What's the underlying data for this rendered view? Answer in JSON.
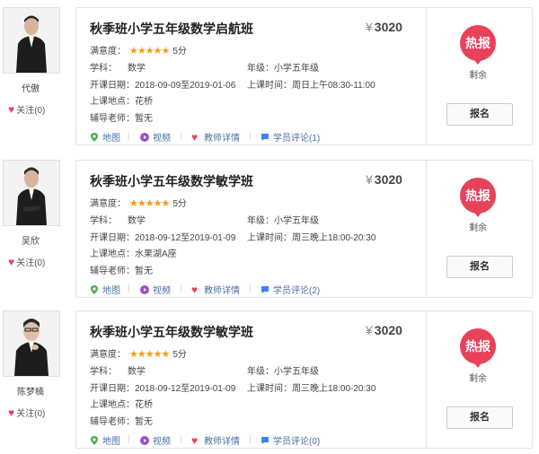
{
  "labels": {
    "follow": "关注(0)",
    "satisfaction": "满意度：",
    "subject": "学科：",
    "grade": "年级：",
    "dates": "开课日期：",
    "time": "上课时间：",
    "location": "上课地点：",
    "tutor": "辅导老师：",
    "badge": "热报",
    "remain": "剩余",
    "signup": "报名",
    "map": "地图",
    "video": "视频",
    "teacher_detail": "教师详情",
    "currency": "¥"
  },
  "courses": [
    {
      "teacher": "代傲",
      "title": "秋季班小学五年级数学启航班",
      "price": "3020",
      "stars": "★★★★★",
      "score": "5分",
      "subject": "数学",
      "grade": "小学五年级",
      "dates": "2018-09-09至2019-01-06",
      "time": "周日上午08:30-11:00",
      "location": "花桥",
      "tutor": "暂无",
      "reviews": "学员评论(1)"
    },
    {
      "teacher": "吴欣",
      "title": "秋季班小学五年级数学敏学班",
      "price": "3020",
      "stars": "★★★★★",
      "score": "5分",
      "subject": "数学",
      "grade": "小学五年级",
      "dates": "2018-09-12至2019-01-09",
      "time": "周三晚上18:00-20:30",
      "location": "水果湖A座",
      "tutor": "暂无",
      "reviews": "学员评论(2)"
    },
    {
      "teacher": "陈梦楠",
      "title": "秋季班小学五年级数学敏学班",
      "price": "3020",
      "stars": "★★★★★",
      "score": "5分",
      "subject": "数学",
      "grade": "小学五年级",
      "dates": "2018-09-12至2019-01-09",
      "time": "周三晚上18:00-20:30",
      "location": "花桥",
      "tutor": "暂无",
      "reviews": "学员评论(0)"
    }
  ],
  "colors": {
    "accent_red": "#e8425b",
    "star": "#f39c12",
    "link": "#4a6fa5",
    "map_icon": "#4caf50",
    "video_icon": "#9c4dcc",
    "review_icon": "#3b82f6"
  }
}
